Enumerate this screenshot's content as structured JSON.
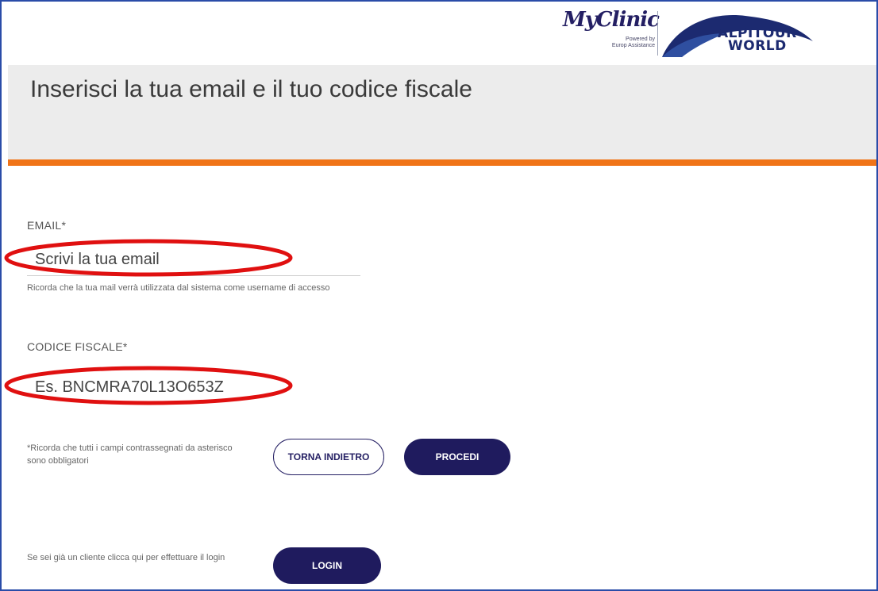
{
  "branding": {
    "myclinic_title": "MyClinic",
    "myclinic_powered": "Powered by",
    "myclinic_partner": "Europ Assistance",
    "alpitour_line1": "ALPITOUR",
    "alpitour_line2": "WORLD"
  },
  "header": {
    "title": "Inserisci la tua email e il tuo codice fiscale"
  },
  "form": {
    "email_label": "EMAIL*",
    "email_placeholder": "Scrivi la tua email",
    "email_help": "Ricorda che la tua mail verrà utilizzata dal sistema come username di accesso",
    "cf_label": "CODICE FISCALE*",
    "cf_placeholder": "Es. BNCMRA70L13O653Z",
    "required_note": "*Ricorda che tutti i campi contrassegnati da asterisco sono obbligatori",
    "back_button": "TORNA INDIETRO",
    "proceed_button": "PROCEDI"
  },
  "login": {
    "note": "Se sei già un cliente clicca qui per effettuare il login",
    "button": "LOGIN"
  },
  "colors": {
    "accent_orange": "#f07418",
    "brand_navy": "#1f1b5e",
    "annotation_red": "#e01010"
  }
}
